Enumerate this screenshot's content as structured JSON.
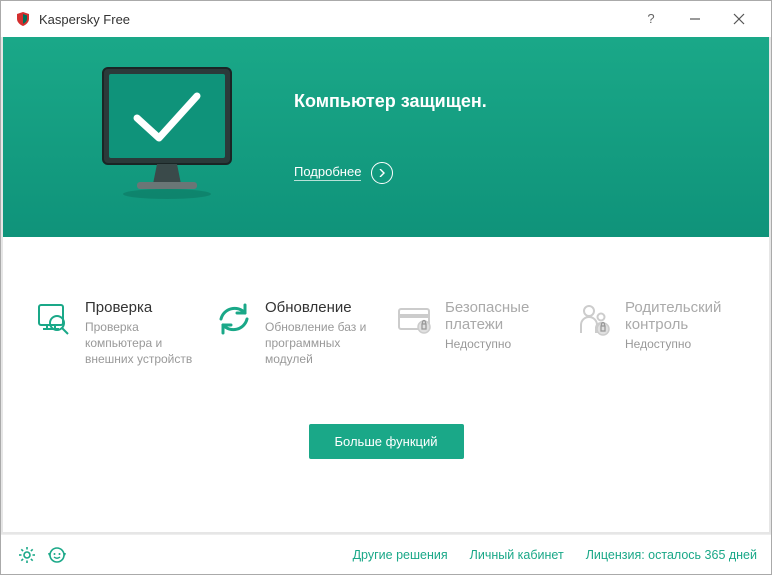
{
  "titlebar": {
    "title": "Kaspersky Free"
  },
  "hero": {
    "title": "Компьютер защищен.",
    "details_label": "Подробнее"
  },
  "features": [
    {
      "title": "Проверка",
      "desc": "Проверка компьютера и внешних устройств",
      "locked": false,
      "icon": "scan"
    },
    {
      "title": "Обновление",
      "desc": "Обновление баз и программных модулей",
      "locked": false,
      "icon": "update"
    },
    {
      "title": "Безопасные платежи",
      "desc": "Недоступно",
      "locked": true,
      "icon": "payments"
    },
    {
      "title": "Родительский контроль",
      "desc": "Недоступно",
      "locked": true,
      "icon": "parental"
    }
  ],
  "more_button": "Больше функций",
  "footer": {
    "links": [
      "Другие решения",
      "Личный кабинет",
      "Лицензия: осталось 365 дней"
    ]
  },
  "colors": {
    "accent": "#1aa888",
    "muted": "#999"
  }
}
